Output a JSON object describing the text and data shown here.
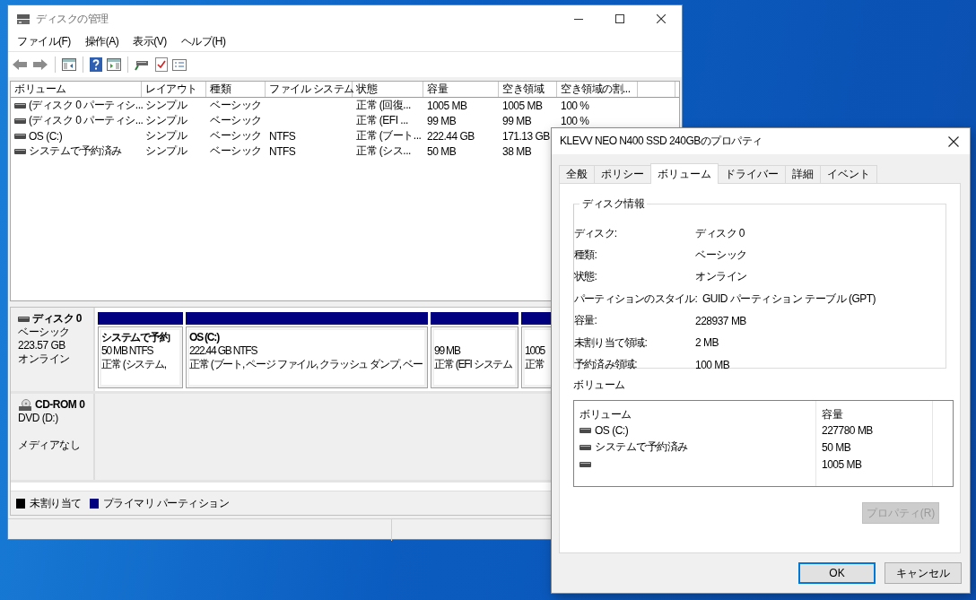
{
  "main_window": {
    "title": "ディスクの管理",
    "menu": [
      "ファイル(F)",
      "操作(A)",
      "表示(V)",
      "ヘルプ(H)"
    ],
    "volume_table": {
      "columns": [
        "ボリューム",
        "レイアウト",
        "種類",
        "ファイル システム",
        "状態",
        "容量",
        "空き領域",
        "空き領域の割..."
      ],
      "rows": [
        {
          "cells": [
            "(ディスク 0 パーティシ...",
            "シンプル",
            "ベーシック",
            "",
            "正常 (回復...",
            "1005 MB",
            "1005 MB",
            "100 %"
          ]
        },
        {
          "cells": [
            "(ディスク 0 パーティシ...",
            "シンプル",
            "ベーシック",
            "",
            "正常 (EFI ...",
            "99 MB",
            "99 MB",
            "100 %"
          ]
        },
        {
          "cells": [
            "OS (C:)",
            "シンプル",
            "ベーシック",
            "NTFS",
            "正常 (ブート...",
            "222.44 GB",
            "171.13 GB"
          ]
        },
        {
          "cells": [
            "システムで予約済み",
            "シンプル",
            "ベーシック",
            "NTFS",
            "正常 (シス...",
            "50 MB",
            "38 MB"
          ]
        }
      ]
    },
    "disks": [
      {
        "kind": "disk",
        "name": "ディスク 0",
        "lines": [
          "ベーシック",
          "223.57 GB",
          "オンライン"
        ],
        "partitions": [
          {
            "title": "システムで予約",
            "lines": [
              "50 MB NTFS",
              "正常 (システム,"
            ]
          },
          {
            "title": "OS  (C:)",
            "lines": [
              "222.44 GB NTFS",
              "正常 (ブート, ページ ファイル, クラッシュ ダンプ, ベー"
            ]
          },
          {
            "lines": [
              "99 MB",
              "正常 (EFI システム"
            ]
          },
          {
            "lines": [
              "1005",
              "正常"
            ]
          }
        ]
      },
      {
        "kind": "cdrom",
        "name": "CD-ROM 0",
        "lines": [
          "DVD (D:)"
        ],
        "status": "メディアなし"
      }
    ],
    "legend": [
      {
        "label": "未割り当て",
        "color": "#000000"
      },
      {
        "label": "プライマリ パーティション",
        "color": "#000080"
      }
    ]
  },
  "dialog": {
    "title": "KLEVV NEO N400 SSD 240GBのプロパティ",
    "tabs": [
      {
        "label": "全般",
        "selected": false
      },
      {
        "label": "ポリシー",
        "selected": false
      },
      {
        "label": "ボリューム",
        "selected": true
      },
      {
        "label": "ドライバー",
        "selected": false
      },
      {
        "label": "詳細",
        "selected": false
      },
      {
        "label": "イベント",
        "selected": false
      }
    ],
    "disk_info": {
      "title": "ディスク情報",
      "fields": [
        {
          "label": "ディスク:",
          "value": "ディスク 0"
        },
        {
          "label": "種類:",
          "value": "ベーシック"
        },
        {
          "label": "状態:",
          "value": "オンライン"
        },
        {
          "label": "パーティションのスタイル:",
          "value": "GUID パーティション テーブル (GPT)"
        },
        {
          "label": "容量:",
          "value": "228937 MB"
        },
        {
          "label": "未割り当て領域:",
          "value": "2 MB"
        },
        {
          "label": "予約済み領域:",
          "value": "100 MB"
        }
      ]
    },
    "volumes_title": "ボリューム",
    "volume_list": {
      "columns": [
        "ボリューム",
        "容量"
      ],
      "rows": [
        {
          "name": "OS (C:)",
          "size": "227780 MB"
        },
        {
          "name": "システムで予約済み",
          "size": "50 MB"
        },
        {
          "size": "1005 MB"
        }
      ]
    },
    "properties_button": {
      "label": "プロパティ(R)",
      "disabled": true
    },
    "buttons": [
      {
        "label": "OK",
        "default": true
      },
      {
        "label": "キャンセル",
        "default": false
      }
    ]
  }
}
